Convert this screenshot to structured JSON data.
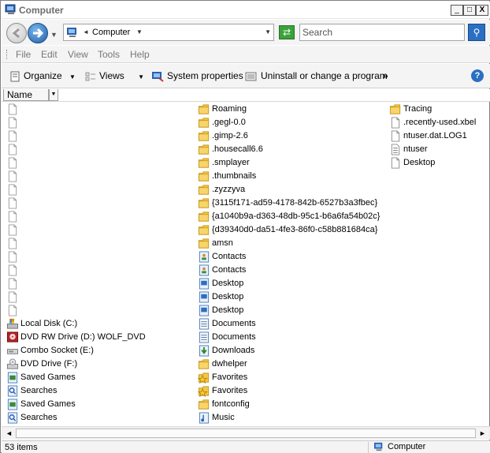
{
  "window": {
    "title": "Computer",
    "minimize": "_",
    "maximize": "□",
    "close": "X"
  },
  "address": {
    "location": "Computer",
    "search_placeholder": "Search"
  },
  "menu": [
    "File",
    "Edit",
    "View",
    "Tools",
    "Help"
  ],
  "toolbar": {
    "organize": "Organize",
    "views": "Views",
    "system_properties": "System properties",
    "uninstall": "Uninstall or change a program",
    "more": "»"
  },
  "header": {
    "name": "Name"
  },
  "columns": [
    [
      {
        "label": "",
        "icon": "blank-file-icon"
      },
      {
        "label": "",
        "icon": "blank-file-icon"
      },
      {
        "label": "",
        "icon": "blank-file-icon"
      },
      {
        "label": "",
        "icon": "blank-file-icon"
      },
      {
        "label": "",
        "icon": "blank-file-icon"
      },
      {
        "label": "",
        "icon": "blank-file-icon"
      },
      {
        "label": "",
        "icon": "blank-file-icon"
      },
      {
        "label": "",
        "icon": "blank-file-icon"
      },
      {
        "label": "",
        "icon": "blank-file-icon"
      },
      {
        "label": "",
        "icon": "blank-file-icon"
      },
      {
        "label": "",
        "icon": "blank-file-icon"
      },
      {
        "label": "",
        "icon": "blank-file-icon"
      },
      {
        "label": "",
        "icon": "blank-file-icon"
      },
      {
        "label": "",
        "icon": "blank-file-icon"
      },
      {
        "label": "",
        "icon": "blank-file-icon"
      },
      {
        "label": "",
        "icon": "blank-file-icon"
      },
      {
        "label": "Local Disk (C:)",
        "icon": "local-disk-icon"
      },
      {
        "label": "DVD RW Drive (D:) WOLF_DVD",
        "icon": "dvd-rw-icon"
      },
      {
        "label": "Combo Socket (E:)",
        "icon": "removable-drive-icon"
      },
      {
        "label": "DVD Drive (F:)",
        "icon": "dvd-drive-icon"
      },
      {
        "label": "Saved Games",
        "icon": "saved-games-icon"
      },
      {
        "label": "Searches",
        "icon": "searches-icon"
      },
      {
        "label": "Saved Games",
        "icon": "saved-games-icon"
      },
      {
        "label": "Searches",
        "icon": "searches-icon"
      }
    ],
    [
      {
        "label": "Roaming",
        "icon": "folder-icon"
      },
      {
        "label": ".gegl-0.0",
        "icon": "folder-icon"
      },
      {
        "label": ".gimp-2.6",
        "icon": "folder-icon"
      },
      {
        "label": ".housecall6.6",
        "icon": "folder-icon"
      },
      {
        "label": ".smplayer",
        "icon": "folder-icon"
      },
      {
        "label": ".thumbnails",
        "icon": "folder-icon"
      },
      {
        "label": ".zyzzyva",
        "icon": "folder-icon"
      },
      {
        "label": "{3115f171-ad59-4178-842b-6527b3a3fbec}",
        "icon": "folder-icon"
      },
      {
        "label": "{a1040b9a-d363-48db-95c1-b6a6fa54b02c}",
        "icon": "folder-icon"
      },
      {
        "label": "{d39340d0-da51-4fe3-86f0-c58b881684ca}",
        "icon": "folder-icon"
      },
      {
        "label": "amsn",
        "icon": "folder-icon"
      },
      {
        "label": "Contacts",
        "icon": "contacts-icon"
      },
      {
        "label": "Contacts",
        "icon": "contacts-icon"
      },
      {
        "label": "Desktop",
        "icon": "desktop-folder-icon"
      },
      {
        "label": "Desktop",
        "icon": "desktop-folder-icon"
      },
      {
        "label": "Desktop",
        "icon": "desktop-folder-icon"
      },
      {
        "label": "Documents",
        "icon": "documents-icon"
      },
      {
        "label": "Documents",
        "icon": "documents-icon"
      },
      {
        "label": "Downloads",
        "icon": "downloads-icon"
      },
      {
        "label": "dwhelper",
        "icon": "folder-icon"
      },
      {
        "label": "Favorites",
        "icon": "favorites-icon"
      },
      {
        "label": "Favorites",
        "icon": "favorites-icon"
      },
      {
        "label": "fontconfig",
        "icon": "folder-icon"
      },
      {
        "label": "Music",
        "icon": "music-icon"
      }
    ],
    [
      {
        "label": "Tracing",
        "icon": "folder-icon"
      },
      {
        "label": ".recently-used.xbel",
        "icon": "file-icon"
      },
      {
        "label": "ntuser.dat.LOG1",
        "icon": "file-icon"
      },
      {
        "label": "ntuser",
        "icon": "text-file-icon"
      },
      {
        "label": "Desktop",
        "icon": "file-icon"
      }
    ]
  ],
  "status": {
    "count": "53 items",
    "location": "Computer"
  },
  "scroll": {
    "left": "◄",
    "right": "►"
  }
}
